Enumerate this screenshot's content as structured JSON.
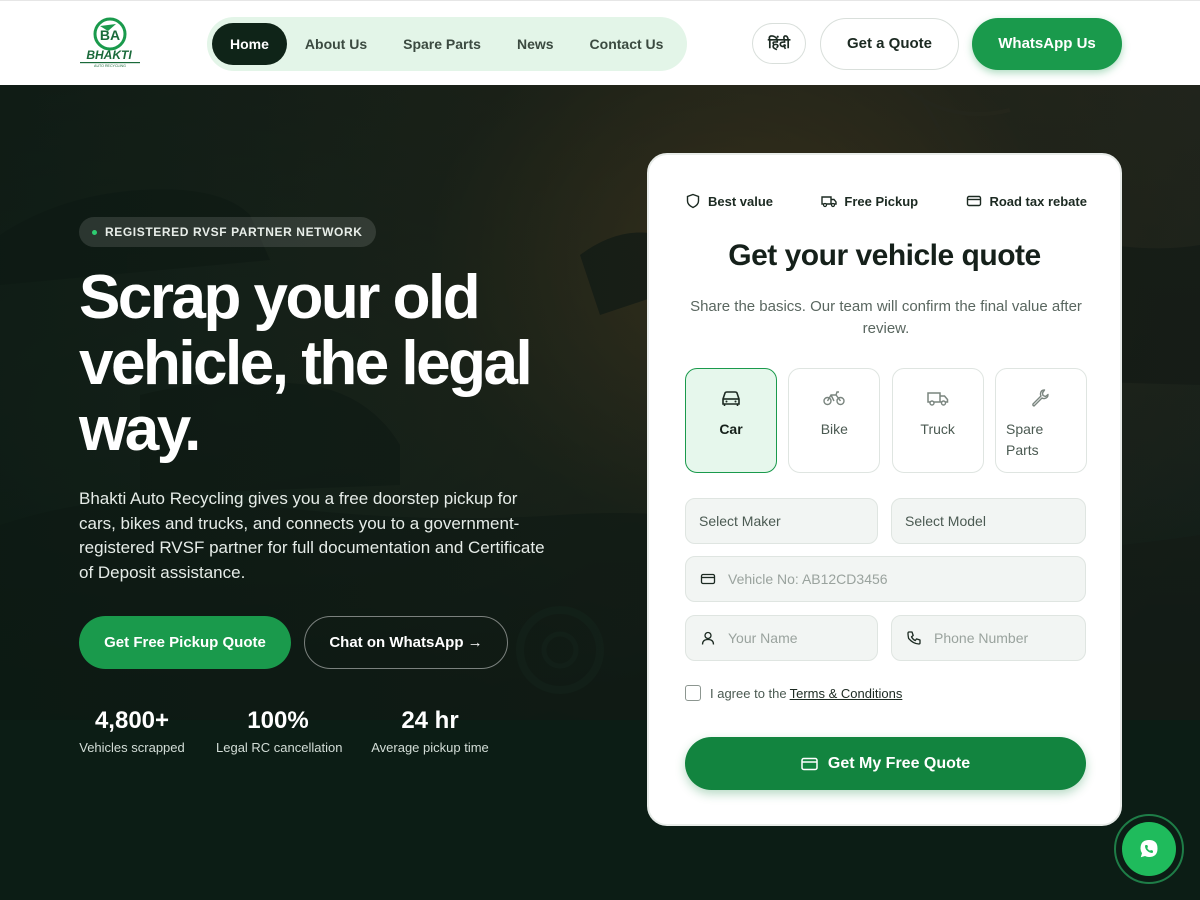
{
  "header": {
    "logo_text": "BHAKTI",
    "logo_sub": "AUTO RECYCLING",
    "nav": [
      {
        "label": "Home"
      },
      {
        "label": "About Us"
      },
      {
        "label": "Spare Parts"
      },
      {
        "label": "News"
      },
      {
        "label": "Contact Us"
      }
    ],
    "lang_label": "हिंदी",
    "quote_label": "Get a Quote",
    "whatsapp_label": "WhatsApp Us"
  },
  "hero": {
    "badge": "REGISTERED RVSF PARTNER NETWORK",
    "headline": "Scrap your old vehicle, the legal way.",
    "subtext": "Bhakti Auto Recycling gives you a free doorstep pickup for cars, bikes and trucks, and connects you to a government-registered RVSF partner for full documentation and Certificate of Deposit assistance.",
    "cta_primary": "Get Free Pickup Quote",
    "cta_secondary": "Chat on WhatsApp →",
    "stats": [
      {
        "value": "4,800+",
        "label": "Vehicles scrapped"
      },
      {
        "value": "100%",
        "label": "Legal RC cancellation"
      },
      {
        "value": "24 hr",
        "label": "Average pickup time"
      }
    ]
  },
  "quote_card": {
    "perks": [
      {
        "label": "Best value",
        "icon": "shield-icon"
      },
      {
        "label": "Free Pickup",
        "icon": "truck-icon"
      },
      {
        "label": "Road tax rebate",
        "icon": "card-icon"
      }
    ],
    "title": "Get your vehicle quote",
    "subtitle": "Share the basics. Our team will confirm the final value after review.",
    "vehicle_types": [
      {
        "label": "Car",
        "icon": "car-icon",
        "selected": true
      },
      {
        "label": "Bike",
        "icon": "bike-icon",
        "selected": false
      },
      {
        "label": "Truck",
        "icon": "truck-icon",
        "selected": false
      },
      {
        "label": "Spare Parts",
        "icon": "wrench-icon",
        "selected": false
      }
    ],
    "maker_select": "Select Maker",
    "model_select": "Select Model",
    "vehicle_no_placeholder": "Vehicle No: AB12CD3456",
    "name_placeholder": "Your Name",
    "phone_placeholder": "Phone Number",
    "agree_text": "I agree to the",
    "terms_link": "Terms & Conditions",
    "submit_label": "Get My Free Quote"
  },
  "colors": {
    "brand_green": "#1a9a4c",
    "dark": "#0f2418",
    "nav_bg": "#e3f5e8"
  }
}
